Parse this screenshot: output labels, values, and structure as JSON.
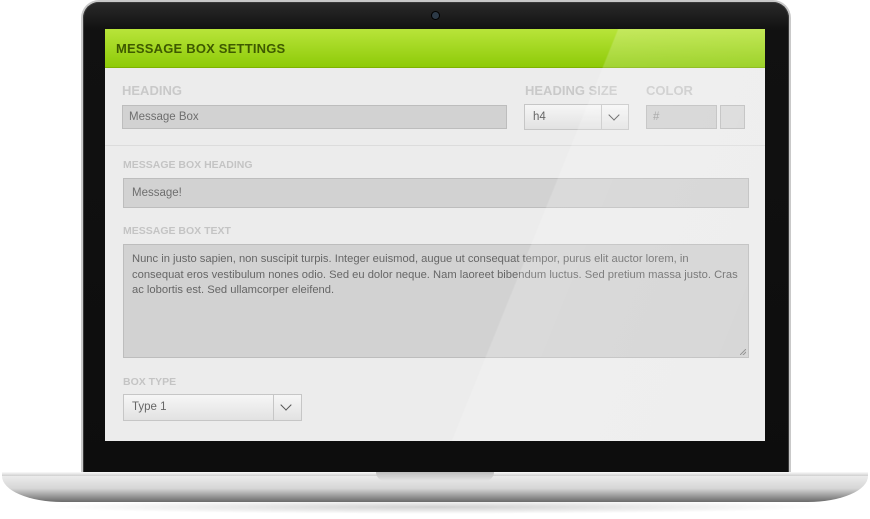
{
  "panel": {
    "title": "MESSAGE BOX SETTINGS"
  },
  "heading": {
    "label": "HEADING",
    "value": "Message Box"
  },
  "heading_size": {
    "label": "HEADING SIZE",
    "selected": "h4"
  },
  "color": {
    "label": "COLOR",
    "placeholder": "#"
  },
  "message_box_heading": {
    "label": "MESSAGE BOX HEADING",
    "value": "Message!"
  },
  "message_box_text": {
    "label": "MESSAGE BOX TEXT",
    "value": "Nunc in justo sapien, non suscipit turpis. Integer euismod, augue ut consequat tempor, purus elit auctor lorem, in consequat eros vestibulum nones odio. Sed eu dolor neque. Nam laoreet bibendum luctus. Sed pretium massa justo. Cras ac lobortis est. Sed ullamcorper eleifend."
  },
  "box_type": {
    "label": "BOX TYPE",
    "selected": "Type 1"
  },
  "colors": {
    "accent": "#9bd21a",
    "title_text": "#3e5a00"
  }
}
